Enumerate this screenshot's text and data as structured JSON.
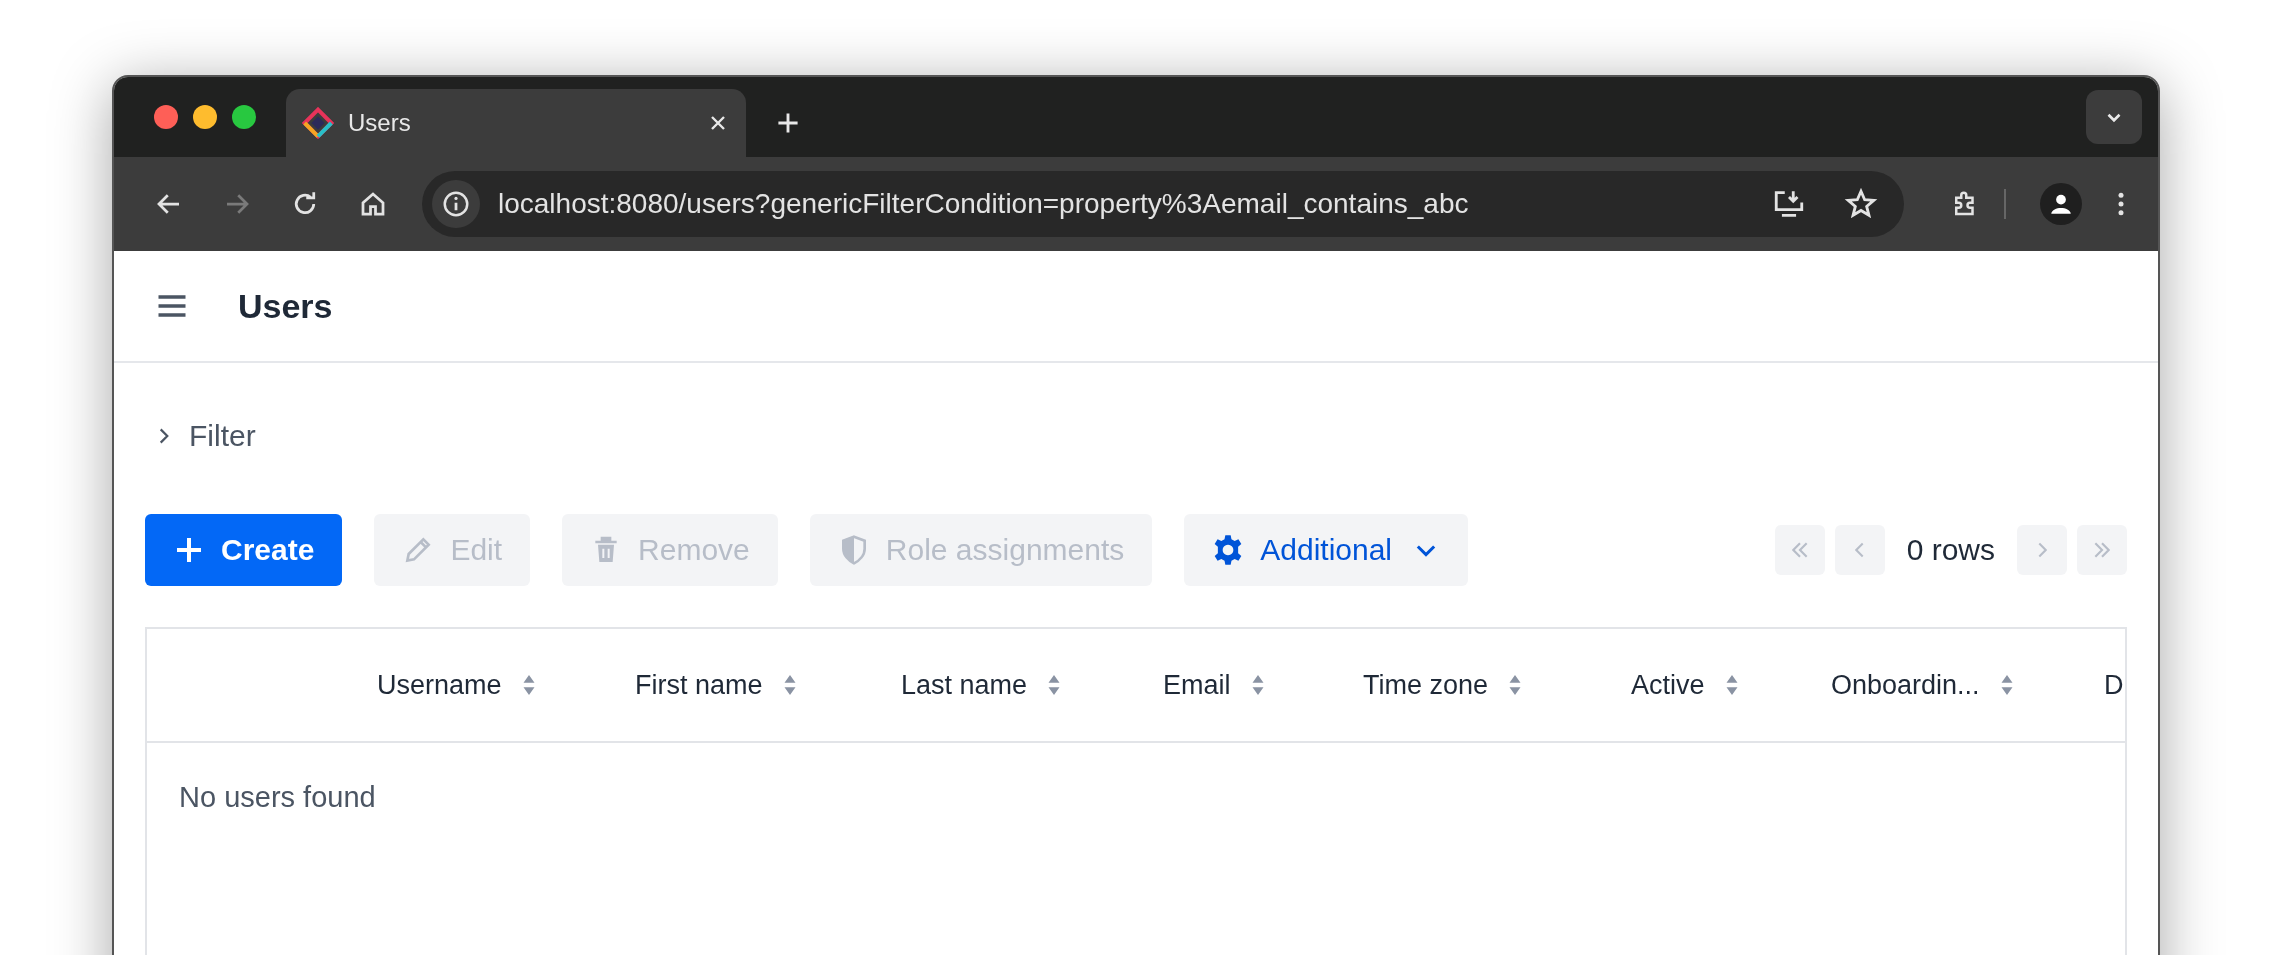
{
  "browser": {
    "tab": {
      "title": "Users",
      "selected": true
    },
    "address": "localhost:8080/users?genericFilterCondition=property%3Aemail_contains_abc",
    "forward_disabled": true
  },
  "header": {
    "title": "Users"
  },
  "filter": {
    "label": "Filter",
    "expanded": false
  },
  "actions": [
    {
      "label": "Create",
      "kind": "create",
      "disabled": false
    },
    {
      "label": "Edit",
      "kind": "edit",
      "disabled": true
    },
    {
      "label": "Remove",
      "kind": "remove",
      "disabled": true
    },
    {
      "label": "Role assignments",
      "kind": "roles",
      "disabled": true
    },
    {
      "label": "Additional",
      "kind": "additional",
      "disabled": false
    }
  ],
  "pagination": {
    "first_disabled": true,
    "prev_disabled": true,
    "count": "0 rows",
    "next_disabled": true,
    "last_disabled": true
  },
  "table": {
    "columns": [
      {
        "label": "Username",
        "sortable": true
      },
      {
        "label": "First name",
        "sortable": true
      },
      {
        "label": "Last name",
        "sortable": true
      },
      {
        "label": "Email",
        "sortable": true
      },
      {
        "label": "Time zone",
        "sortable": true
      },
      {
        "label": "Active",
        "sortable": true
      },
      {
        "label": "Onboardin...",
        "sortable": true
      },
      {
        "label": "D"
      }
    ],
    "empty_message": "No users found"
  }
}
